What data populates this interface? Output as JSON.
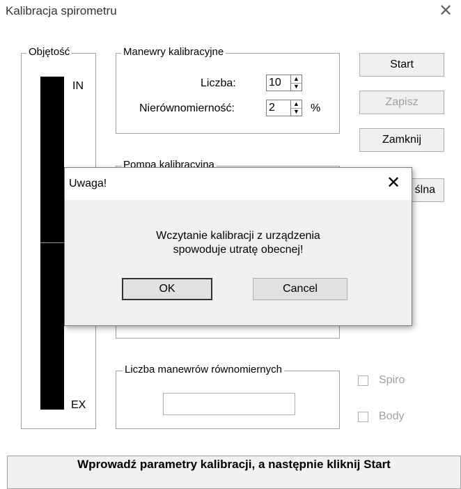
{
  "window": {
    "title": "Kalibracja spirometru",
    "close_glyph": "✕"
  },
  "volume": {
    "legend": "Objętość",
    "in_label": "IN",
    "ex_label": "EX"
  },
  "maneuvers": {
    "legend": "Manewry kalibracyjne",
    "count_label": "Liczba:",
    "count_value": "10",
    "nonuniformity_label": "Nierównomierność:",
    "nonuniformity_value": "2",
    "percent_sign": "%"
  },
  "pump": {
    "legend": "Pompa kalibracyjna"
  },
  "uniform": {
    "legend": "Liczba manewrów równomiernych",
    "value": ""
  },
  "buttons": {
    "start": "Start",
    "save": "Zapisz",
    "close": "Zamknij",
    "default_partial": "ślna"
  },
  "checkboxes": {
    "spiro": "Spiro",
    "body": "Body"
  },
  "status": {
    "text": "Wprowadź parametry kalibracji, a następnie kliknij Start"
  },
  "dialog": {
    "title": "Uwaga!",
    "close_glyph": "✕",
    "message_line1": "Wczytanie kalibracji z urządzenia",
    "message_line2": "spowoduje utratę obecnej!",
    "ok": "OK",
    "cancel": "Cancel"
  },
  "icons": {
    "spin_up": "arrow-up-icon",
    "spin_down": "arrow-down-icon"
  }
}
